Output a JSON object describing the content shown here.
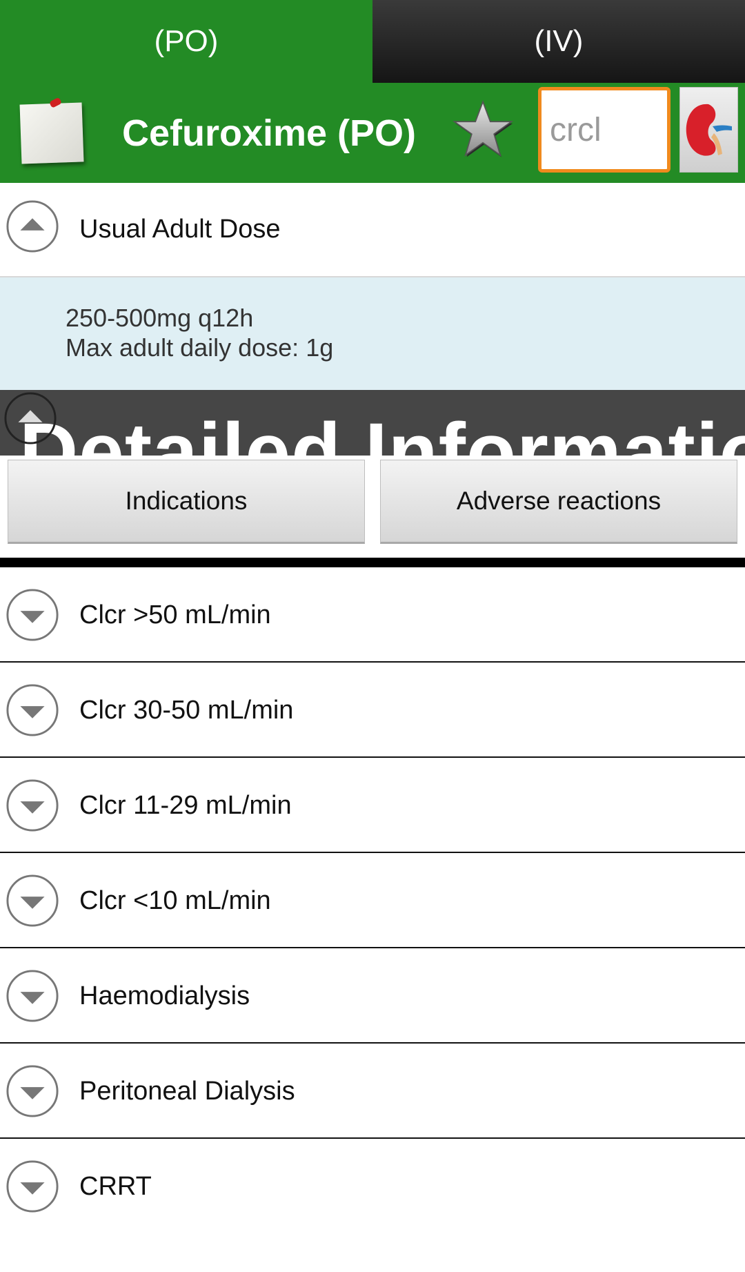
{
  "tabs": [
    {
      "label": "(PO)",
      "selected": true
    },
    {
      "label": "(IV)",
      "selected": false
    }
  ],
  "header": {
    "title": "Cefuroxime (PO)",
    "crcl_placeholder": "crcl",
    "crcl_value": ""
  },
  "usual_dose": {
    "label": "Usual Adult Dose",
    "expanded": true,
    "lines": [
      "250-500mg q12h",
      "Max adult daily dose: 1g"
    ]
  },
  "detailed": {
    "label": "Detailed Information"
  },
  "buttons": {
    "indications": "Indications",
    "adverse_reactions": "Adverse reactions"
  },
  "renal_sections": [
    {
      "label": "Clcr >50 mL/min",
      "expanded": false
    },
    {
      "label": "Clcr 30-50 mL/min",
      "expanded": false
    },
    {
      "label": "Clcr 11-29 mL/min",
      "expanded": false
    },
    {
      "label": "Clcr <10 mL/min",
      "expanded": false
    },
    {
      "label": "Haemodialysis",
      "expanded": false
    },
    {
      "label": "Peritoneal Dialysis",
      "expanded": false
    },
    {
      "label": "CRRT",
      "expanded": false
    }
  ],
  "colors": {
    "header_green": "#238b25",
    "input_border": "#f08a1d",
    "dose_panel_bg": "#dfeff4",
    "detailed_bar": "#464646"
  },
  "icons": [
    "note-icon",
    "star-icon",
    "kidney-icon",
    "collapse-arrow-icon",
    "expand-arrow-icon"
  ]
}
